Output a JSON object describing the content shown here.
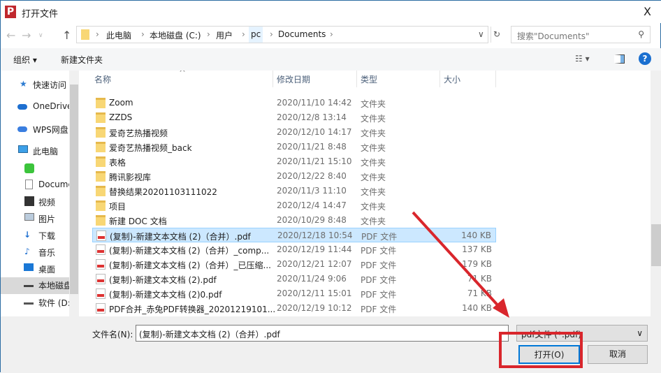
{
  "window": {
    "title": "打开文件",
    "close": "X"
  },
  "address": {
    "crumbs": [
      "此电脑",
      "本地磁盘 (C:)",
      "用户",
      "pc",
      "Documents"
    ],
    "search_placeholder": "搜索\"Documents\""
  },
  "toolbar": {
    "organize": "组织 ▾",
    "new_folder": "新建文件夹"
  },
  "sidebar": {
    "items": [
      "快速访问",
      "OneDrive",
      "WPS网盘",
      "此电脑",
      "",
      "Documents",
      "视频",
      "图片",
      "下载",
      "音乐",
      "桌面",
      "本地磁盘 (C:)",
      "软件 (D:)"
    ]
  },
  "columns": {
    "name": "名称",
    "date": "修改日期",
    "type": "类型",
    "size": "大小"
  },
  "files": [
    {
      "name": "Zoom",
      "date": "2020/11/10 14:42",
      "type": "文件夹",
      "size": "",
      "kind": "folder"
    },
    {
      "name": "ZZDS",
      "date": "2020/12/8 13:14",
      "type": "文件夹",
      "size": "",
      "kind": "folder"
    },
    {
      "name": "爱奇艺热播视频",
      "date": "2020/12/10 14:17",
      "type": "文件夹",
      "size": "",
      "kind": "folder"
    },
    {
      "name": "爱奇艺热播视频_back",
      "date": "2020/11/21 8:48",
      "type": "文件夹",
      "size": "",
      "kind": "folder"
    },
    {
      "name": "表格",
      "date": "2020/11/21 15:10",
      "type": "文件夹",
      "size": "",
      "kind": "folder"
    },
    {
      "name": "腾讯影视库",
      "date": "2020/12/22 8:40",
      "type": "文件夹",
      "size": "",
      "kind": "folder"
    },
    {
      "name": "替换结果20201103111022",
      "date": "2020/11/3 11:10",
      "type": "文件夹",
      "size": "",
      "kind": "folder"
    },
    {
      "name": "项目",
      "date": "2020/12/4 14:47",
      "type": "文件夹",
      "size": "",
      "kind": "folder"
    },
    {
      "name": "新建 DOC 文档",
      "date": "2020/10/29 8:48",
      "type": "文件夹",
      "size": "",
      "kind": "folder"
    },
    {
      "name": "(复制)-新建文本文档 (2)（合并）.pdf",
      "date": "2020/12/18 10:54",
      "type": "PDF 文件",
      "size": "140 KB",
      "kind": "pdf",
      "selected": true
    },
    {
      "name": "(复制)-新建文本文档 (2)（合并）_comp...",
      "date": "2020/12/19 11:44",
      "type": "PDF 文件",
      "size": "137 KB",
      "kind": "pdf"
    },
    {
      "name": "(复制)-新建文本文档 (2)（合并）_已压缩...",
      "date": "2020/12/21 12:07",
      "type": "PDF 文件",
      "size": "179 KB",
      "kind": "pdf"
    },
    {
      "name": "(复制)-新建文本文档 (2).pdf",
      "date": "2020/11/24 9:06",
      "type": "PDF 文件",
      "size": "71 KB",
      "kind": "pdf"
    },
    {
      "name": "(复制)-新建文本文档 (2)0.pdf",
      "date": "2020/12/11 15:01",
      "type": "PDF 文件",
      "size": "71 KB",
      "kind": "pdf"
    },
    {
      "name": "PDF合并_赤兔PDF转换器_20201219101...",
      "date": "2020/12/19 10:12",
      "type": "PDF 文件",
      "size": "140 KB",
      "kind": "pdf"
    }
  ],
  "footer": {
    "filename_label": "文件名(N):",
    "filename_value": "(复制)-新建文本文档 (2)（合并）.pdf",
    "filter": "pdf文件 (*.pdf)",
    "open": "打开(O)",
    "cancel": "取消"
  }
}
